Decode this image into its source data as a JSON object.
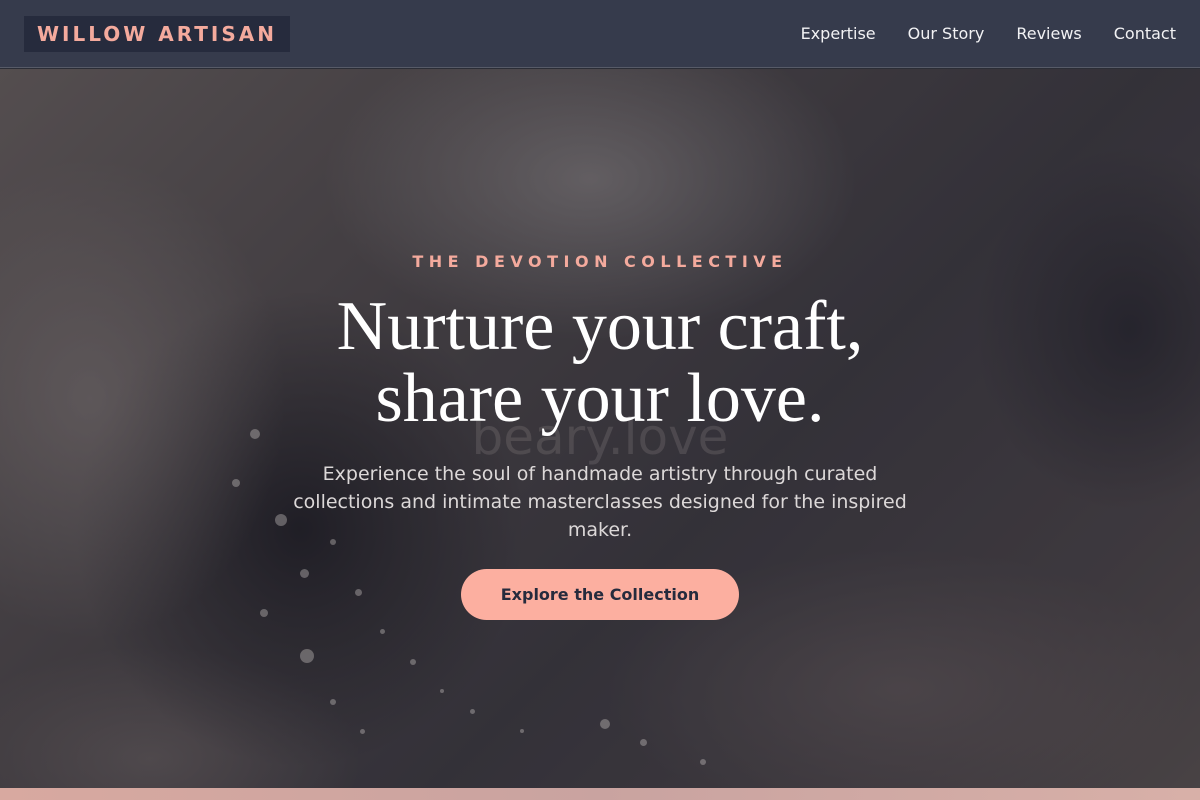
{
  "brand": {
    "name": "WILLOW ARTISAN"
  },
  "nav": {
    "items": [
      {
        "label": "Expertise"
      },
      {
        "label": "Our Story"
      },
      {
        "label": "Reviews"
      },
      {
        "label": "Contact"
      }
    ]
  },
  "hero": {
    "eyebrow": "THE DEVOTION COLLECTIVE",
    "headline_line1": "Nurture your craft,",
    "headline_line2": "share your love.",
    "watermark": "beary.love",
    "subtitle": "Experience the soul of handmade artistry through curated collections and intimate masterclasses designed for the inspired maker.",
    "cta_label": "Explore the Collection"
  },
  "colors": {
    "accent": "#fcafa0",
    "header_bg": "#363b4c",
    "logo_bg": "#262b3d"
  }
}
